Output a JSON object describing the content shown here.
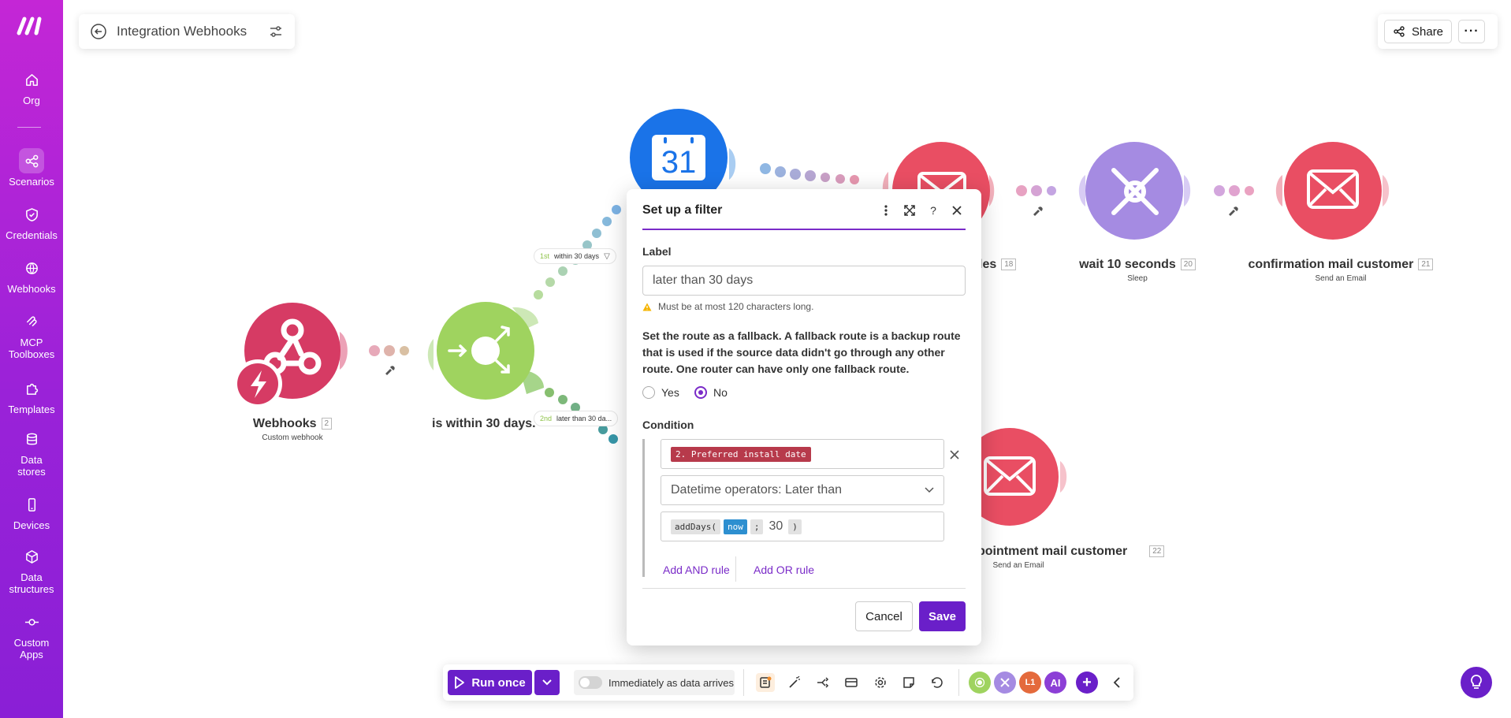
{
  "sidebar": {
    "items": [
      {
        "label": "Org",
        "icon": "home-icon"
      },
      {
        "label": "Scenarios",
        "icon": "share-nodes-icon",
        "active": true
      },
      {
        "label": "Credentials",
        "icon": "shield-check-icon"
      },
      {
        "label": "Webhooks",
        "icon": "globe-icon"
      },
      {
        "label": "MCP Toolboxes",
        "icon": "mcp-icon"
      },
      {
        "label": "Templates",
        "icon": "puzzle-icon"
      },
      {
        "label": "Data stores",
        "icon": "database-icon"
      },
      {
        "label": "Devices",
        "icon": "phone-icon"
      },
      {
        "label": "Data structures",
        "icon": "cube-icon"
      },
      {
        "label": "Custom Apps",
        "icon": "commit-icon"
      }
    ]
  },
  "header": {
    "title": "Integration Webhooks",
    "share_label": "Share",
    "more_label": "···"
  },
  "canvas": {
    "modules": [
      {
        "name": "Webhooks",
        "badge": "2",
        "sub": "Custom webhook",
        "color": "#d63b64"
      },
      {
        "name": "is within 30 days.",
        "badge": "",
        "sub": "",
        "color": "#9fd35f"
      },
      {
        "name": "les",
        "badge": "18",
        "sub": "",
        "color": "#e94e63"
      },
      {
        "name": "wait 10 seconds",
        "badge": "20",
        "sub": "Sleep",
        "color": "#a58be2"
      },
      {
        "name": "confirmation mail customer",
        "badge": "21",
        "sub": "Send an Email",
        "color": "#e94e63"
      },
      {
        "name": "pointment mail customer",
        "badge": "22",
        "sub": "Send an Email",
        "color": "#e94e63"
      }
    ],
    "calendar_day": "31",
    "routes": [
      {
        "order": "1st",
        "label": "within 30 days"
      },
      {
        "order": "2nd",
        "label": "later than 30 da..."
      }
    ]
  },
  "filter_modal": {
    "title": "Set up a filter",
    "label_heading": "Label",
    "label_value": "later than 30 days",
    "hint": "Must be at most 120 characters long.",
    "fallback_text": "Set the route as a fallback. A fallback route is a backup route that is used if the source data didn't go through any other route. One router can have only one fallback route.",
    "yes_label": "Yes",
    "no_label": "No",
    "fallback_selected": "No",
    "condition_heading": "Condition",
    "field_chip": "2. Preferred install date",
    "operator": "Datetime operators: Later than",
    "value_fn": "addDays(",
    "value_now": "now",
    "value_sep": ";",
    "value_num": "30",
    "value_close": ")",
    "add_and": "Add AND rule",
    "add_or": "Add OR rule",
    "cancel": "Cancel",
    "save": "Save"
  },
  "toolbar": {
    "run_once": "Run once",
    "schedule_label": "Immediately as data arrives",
    "ai_label": "AI",
    "l1_label": "L1"
  },
  "colors": {
    "brand": "#6a1fc9",
    "sidebar_top": "#c426d6",
    "sidebar_bottom": "#8a1fd6"
  }
}
